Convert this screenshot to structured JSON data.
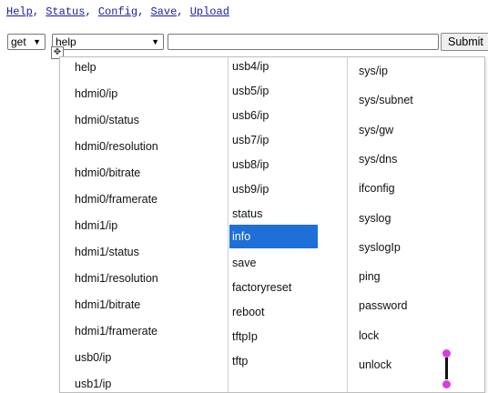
{
  "nav": {
    "links": [
      "Help",
      "Status",
      "Config",
      "Save",
      "Upload"
    ],
    "separator": ","
  },
  "toolbar": {
    "method_value": "get",
    "command_value": "help",
    "input_value": "",
    "submit_label": "Submit"
  },
  "dropdown": {
    "column1": [
      "help",
      "hdmi0/ip",
      "hdmi0/status",
      "hdmi0/resolution",
      "hdmi0/bitrate",
      "hdmi0/framerate",
      "hdmi1/ip",
      "hdmi1/status",
      "hdmi1/resolution",
      "hdmi1/bitrate",
      "hdmi1/framerate",
      "usb0/ip",
      "usb1/ip"
    ],
    "column2": [
      "usb4/ip",
      "usb5/ip",
      "usb6/ip",
      "usb7/ip",
      "usb8/ip",
      "usb9/ip",
      "status",
      "info",
      "save",
      "factoryreset",
      "reboot",
      "tftpIp",
      "tftp"
    ],
    "column3": [
      "sys/ip",
      "sys/subnet",
      "sys/gw",
      "sys/dns",
      "ifconfig",
      "syslog",
      "syslogIp",
      "ping",
      "password",
      "lock",
      "unlock"
    ],
    "highlighted": "info"
  },
  "colors": {
    "highlight": "#1e6fd8",
    "link": "#1a1aa6",
    "handle": "#d63ee0"
  },
  "icons": {
    "move": "move-icon",
    "chevron": "chevron-down-icon",
    "resize": "resize-handle-icon"
  }
}
